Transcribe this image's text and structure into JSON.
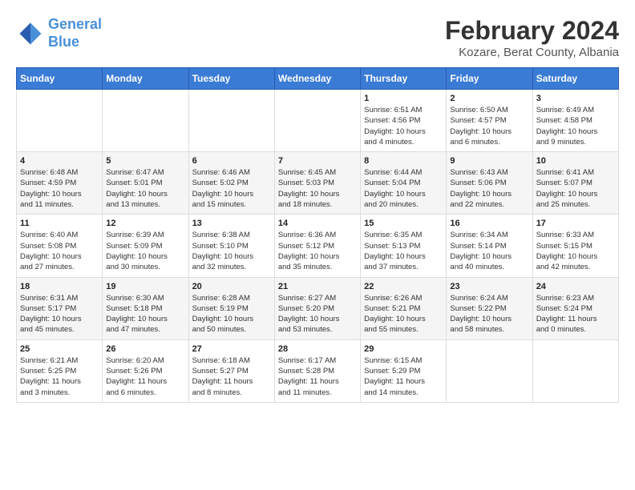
{
  "header": {
    "logo_line1": "General",
    "logo_line2": "Blue",
    "title": "February 2024",
    "subtitle": "Kozare, Berat County, Albania"
  },
  "columns": [
    "Sunday",
    "Monday",
    "Tuesday",
    "Wednesday",
    "Thursday",
    "Friday",
    "Saturday"
  ],
  "weeks": [
    [
      {
        "day": "",
        "info": ""
      },
      {
        "day": "",
        "info": ""
      },
      {
        "day": "",
        "info": ""
      },
      {
        "day": "",
        "info": ""
      },
      {
        "day": "1",
        "info": "Sunrise: 6:51 AM\nSunset: 4:56 PM\nDaylight: 10 hours\nand 4 minutes."
      },
      {
        "day": "2",
        "info": "Sunrise: 6:50 AM\nSunset: 4:57 PM\nDaylight: 10 hours\nand 6 minutes."
      },
      {
        "day": "3",
        "info": "Sunrise: 6:49 AM\nSunset: 4:58 PM\nDaylight: 10 hours\nand 9 minutes."
      }
    ],
    [
      {
        "day": "4",
        "info": "Sunrise: 6:48 AM\nSunset: 4:59 PM\nDaylight: 10 hours\nand 11 minutes."
      },
      {
        "day": "5",
        "info": "Sunrise: 6:47 AM\nSunset: 5:01 PM\nDaylight: 10 hours\nand 13 minutes."
      },
      {
        "day": "6",
        "info": "Sunrise: 6:46 AM\nSunset: 5:02 PM\nDaylight: 10 hours\nand 15 minutes."
      },
      {
        "day": "7",
        "info": "Sunrise: 6:45 AM\nSunset: 5:03 PM\nDaylight: 10 hours\nand 18 minutes."
      },
      {
        "day": "8",
        "info": "Sunrise: 6:44 AM\nSunset: 5:04 PM\nDaylight: 10 hours\nand 20 minutes."
      },
      {
        "day": "9",
        "info": "Sunrise: 6:43 AM\nSunset: 5:06 PM\nDaylight: 10 hours\nand 22 minutes."
      },
      {
        "day": "10",
        "info": "Sunrise: 6:41 AM\nSunset: 5:07 PM\nDaylight: 10 hours\nand 25 minutes."
      }
    ],
    [
      {
        "day": "11",
        "info": "Sunrise: 6:40 AM\nSunset: 5:08 PM\nDaylight: 10 hours\nand 27 minutes."
      },
      {
        "day": "12",
        "info": "Sunrise: 6:39 AM\nSunset: 5:09 PM\nDaylight: 10 hours\nand 30 minutes."
      },
      {
        "day": "13",
        "info": "Sunrise: 6:38 AM\nSunset: 5:10 PM\nDaylight: 10 hours\nand 32 minutes."
      },
      {
        "day": "14",
        "info": "Sunrise: 6:36 AM\nSunset: 5:12 PM\nDaylight: 10 hours\nand 35 minutes."
      },
      {
        "day": "15",
        "info": "Sunrise: 6:35 AM\nSunset: 5:13 PM\nDaylight: 10 hours\nand 37 minutes."
      },
      {
        "day": "16",
        "info": "Sunrise: 6:34 AM\nSunset: 5:14 PM\nDaylight: 10 hours\nand 40 minutes."
      },
      {
        "day": "17",
        "info": "Sunrise: 6:33 AM\nSunset: 5:15 PM\nDaylight: 10 hours\nand 42 minutes."
      }
    ],
    [
      {
        "day": "18",
        "info": "Sunrise: 6:31 AM\nSunset: 5:17 PM\nDaylight: 10 hours\nand 45 minutes."
      },
      {
        "day": "19",
        "info": "Sunrise: 6:30 AM\nSunset: 5:18 PM\nDaylight: 10 hours\nand 47 minutes."
      },
      {
        "day": "20",
        "info": "Sunrise: 6:28 AM\nSunset: 5:19 PM\nDaylight: 10 hours\nand 50 minutes."
      },
      {
        "day": "21",
        "info": "Sunrise: 6:27 AM\nSunset: 5:20 PM\nDaylight: 10 hours\nand 53 minutes."
      },
      {
        "day": "22",
        "info": "Sunrise: 6:26 AM\nSunset: 5:21 PM\nDaylight: 10 hours\nand 55 minutes."
      },
      {
        "day": "23",
        "info": "Sunrise: 6:24 AM\nSunset: 5:22 PM\nDaylight: 10 hours\nand 58 minutes."
      },
      {
        "day": "24",
        "info": "Sunrise: 6:23 AM\nSunset: 5:24 PM\nDaylight: 11 hours\nand 0 minutes."
      }
    ],
    [
      {
        "day": "25",
        "info": "Sunrise: 6:21 AM\nSunset: 5:25 PM\nDaylight: 11 hours\nand 3 minutes."
      },
      {
        "day": "26",
        "info": "Sunrise: 6:20 AM\nSunset: 5:26 PM\nDaylight: 11 hours\nand 6 minutes."
      },
      {
        "day": "27",
        "info": "Sunrise: 6:18 AM\nSunset: 5:27 PM\nDaylight: 11 hours\nand 8 minutes."
      },
      {
        "day": "28",
        "info": "Sunrise: 6:17 AM\nSunset: 5:28 PM\nDaylight: 11 hours\nand 11 minutes."
      },
      {
        "day": "29",
        "info": "Sunrise: 6:15 AM\nSunset: 5:29 PM\nDaylight: 11 hours\nand 14 minutes."
      },
      {
        "day": "",
        "info": ""
      },
      {
        "day": "",
        "info": ""
      }
    ]
  ]
}
